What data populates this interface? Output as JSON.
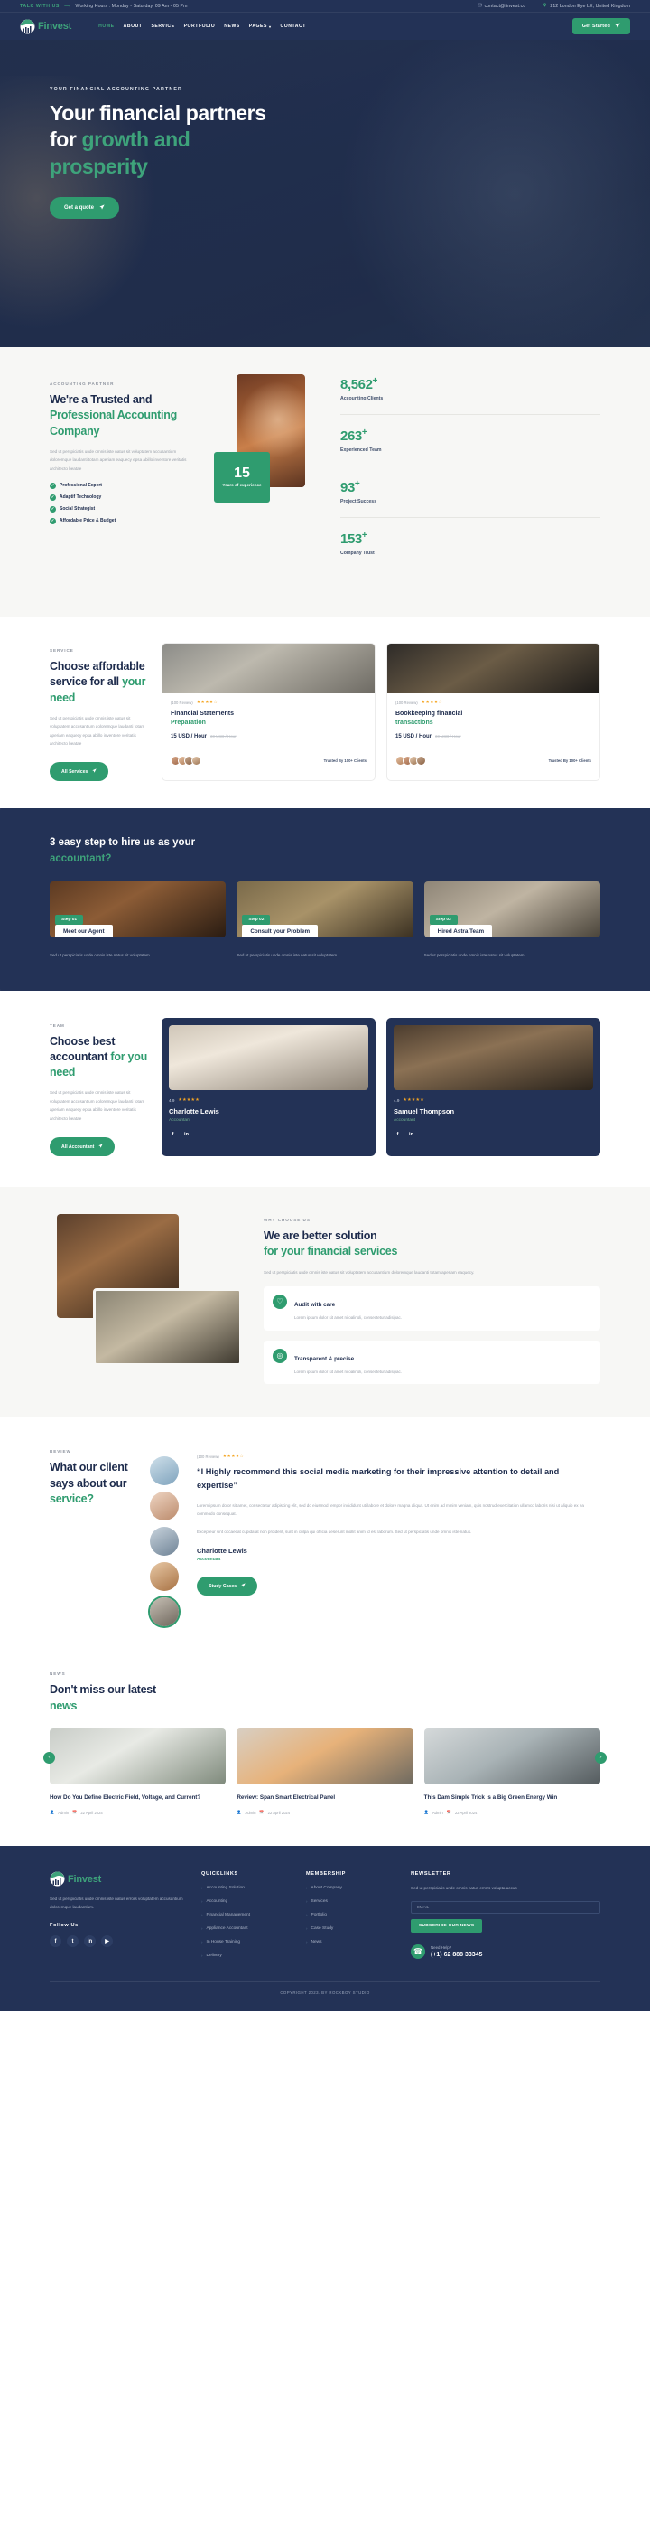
{
  "topbar": {
    "talk_label": "TALK WITH US",
    "hours": "Working Hours : Monday - Saturday, 09 Am - 05 Pm",
    "email": "contact@finvest.co",
    "address": "212 London Eye LE, United Kingdom"
  },
  "header": {
    "brand": "Finvest",
    "nav": [
      {
        "label": "HOME",
        "active": true
      },
      {
        "label": "ABOUT",
        "active": false
      },
      {
        "label": "SERVICE",
        "active": false
      },
      {
        "label": "PORTFOLIO",
        "active": false
      },
      {
        "label": "NEWS",
        "active": false
      },
      {
        "label": "PAGES",
        "active": false,
        "caret": "▾"
      },
      {
        "label": "CONTACT",
        "active": false
      }
    ],
    "cta": "Get Started"
  },
  "hero": {
    "eyebrow": "YOUR FINANCIAL ACCOUNTING PARTNER",
    "title_line1": "Your financial partners",
    "title_line2_white": "for ",
    "title_line2_green": "growth and",
    "title_line3_green": "prosperity",
    "cta": "Get a quote"
  },
  "about": {
    "eyebrow": "ACCOUNTING PARTNER",
    "title_dark": "We're a Trusted and",
    "title_green": "Professional Accounting Company",
    "body": "Sed ut perspiciatis unde omnis iste natus sit voluptatem accusantium doloremque laudanti totam aperiam eaquecy epsa abillo inventore veritatis architecto beatae",
    "checks": [
      "Professional Expert",
      "Adaptif Technology",
      "Social Strategist",
      "Affordable Price & Budget"
    ],
    "badge_number": "15",
    "badge_label": "Years of experience",
    "stats": [
      {
        "value": "8,562",
        "suffix": "+",
        "label": "Accounting Clients"
      },
      {
        "value": "263",
        "suffix": "+",
        "label": "Experienced Team"
      },
      {
        "value": "93",
        "suffix": "+",
        "label": "Project Success"
      },
      {
        "value": "153",
        "suffix": "+",
        "label": "Company Trust"
      }
    ]
  },
  "services": {
    "eyebrow": "SERVICE",
    "title_dark": "Choose affordable service for all",
    "title_green": "your need",
    "body": "Sed ut perspiciatis unde omnis iste natus sit voluptatem accusantium doloremque laudanti totam aperiam eaquecy epsa abillo inventore veritatis architecto beatae",
    "cta": "All Services",
    "cards": [
      {
        "review": "(100 Review)",
        "stars": "★★★★☆",
        "title_dark": "Financial Statements",
        "title_green": "Preparation",
        "price": "15 USD / Hour",
        "price_old": "30 USD / Hour",
        "trusted": "Trusted By 100+ Clients"
      },
      {
        "review": "(100 Review)",
        "stars": "★★★★☆",
        "title_dark": "Bookkeeping financial",
        "title_green": "transactions",
        "price": "15 USD / Hour",
        "price_old": "30 USD / Hour",
        "trusted": "Trusted By 100+ Clients"
      }
    ]
  },
  "steps": {
    "title_white": "3 easy step to hire us as your",
    "title_green": "accountant?",
    "items": [
      {
        "badge": "Step 01",
        "name": "Meet our Agent",
        "text": "Sed ut perspiciatis unde omnis iste natus sit voluptatem."
      },
      {
        "badge": "Step 02",
        "name": "Consult your Problem",
        "text": "Sed ut perspiciatis unde omnis iste natus sit voluptatem."
      },
      {
        "badge": "Step 03",
        "name": "Hired Astra Team",
        "text": "Sed ut perspiciatis unde omnis iste natus sit voluptatem."
      }
    ]
  },
  "team": {
    "eyebrow": "TEAM",
    "title_dark": "Choose best accountant",
    "title_green": "for you need",
    "body": "Sed ut perspiciatis unde omnis iste natus sit voluptatem accusantium doloremque laudanti totam aperiam eaquecy epsa abillo inventore veritatis architecto beatae",
    "cta": "All Accountant",
    "members": [
      {
        "rating": "4.9",
        "stars": "★★★★★",
        "name": "Charlotte Lewis",
        "role": "Accountant",
        "social1": "f",
        "social2": "in"
      },
      {
        "rating": "4.9",
        "stars": "★★★★★",
        "name": "Samuel Thompson",
        "role": "Accountant",
        "social1": "f",
        "social2": "in"
      }
    ]
  },
  "why": {
    "eyebrow": "WHY CHOOSE US",
    "title_dark": "We are better solution",
    "title_green": "for your financial services",
    "body": "Sed ut perspiciatis unde omnis iste natus sit voluptatem accusantium doloremque laudanti totam aperiam eaquecy.",
    "features": [
      {
        "icon": "♡",
        "title": "Audit with care",
        "text": "Lorem ipsum dolor sit amet ni oalinoli, consectetur adisipac."
      },
      {
        "icon": "◎",
        "title": "Transparent & precise",
        "text": "Lorem ipsum dolor sit amet ni oalinoli, consectetur adisipac."
      }
    ]
  },
  "review": {
    "eyebrow": "REVIEW",
    "title_dark": "What our client says about our",
    "title_green": "service?",
    "count": "(100 Review)",
    "stars": "★★★★☆",
    "quote": "“I Highly recommend this social media marketing for their impressive attention to detail and expertise”",
    "para1": "Lorem ipsum dolor sit amet, consectetur adipiscing elit, sed do eiusmod tempor incididunt uti labore et dolore magna aliqua. Ut enim ad minim veniam, quis nostrud exercitation ullamco laboris nisi ut aliquip ex ea commodo consequat.",
    "para2": "Excepteur sint occaecat cupidatat non proident, sunt in culpa qui officia deserunt mollit anim id est laborum. Sed ut perspiciatis unde omnis iste natus.",
    "name": "Charlotte Lewis",
    "role": "Accountant",
    "cta": "Study Cases"
  },
  "news": {
    "eyebrow": "NEWS",
    "title_dark": "Don't miss our latest",
    "title_green": "news",
    "prev": "‹",
    "next": "›",
    "posts": [
      {
        "title": "How Do You Define Electric Field, Voltage, and Current?",
        "author": "Admin",
        "date": "22 April 2024"
      },
      {
        "title": "Review: Span Smart Electrical Panel",
        "author": "Admin",
        "date": "22 April 2024"
      },
      {
        "title": "This Dam Simple Trick Is a Big Green Energy Win",
        "author": "Admin",
        "date": "22 April 2024"
      }
    ]
  },
  "footer": {
    "brand": "Finvest",
    "desc": "Sed ut perspiciatis unde omnis iste natus errors voluptatem accusantium doloremque laudantium.",
    "follow_label": "Follow Us",
    "socials": [
      "f",
      "t",
      "in",
      "▶"
    ],
    "quicklinks_title": "QUICKLINKS",
    "quicklinks": [
      "Accounting Solution",
      "Accounting",
      "Financial Management",
      "Appliance Accountant",
      "In House Training",
      "Delivery"
    ],
    "membership_title": "MEMBERSHIP",
    "membership": [
      "About Company",
      "Services",
      "Portfolio",
      "Case Study",
      "News"
    ],
    "newsletter_title": "NEWSLETTER",
    "newsletter_desc": "Sed ut perspiciatis unde omnis natus errors volupta accus",
    "email_placeholder": "EMAIL",
    "subscribe": "SUBSCRIBE OUR NEWS",
    "need_help": "Need Help?",
    "phone": "(+1) 62 888 33345",
    "copyright": "COPYRIGHT 2023. BY ROCKBOY STUDIO"
  },
  "colors": {
    "navy": "#233256",
    "green": "#2f9c6f",
    "green_light": "#3ea37b",
    "cream": "#f7f7f5",
    "star": "#f5a623"
  }
}
